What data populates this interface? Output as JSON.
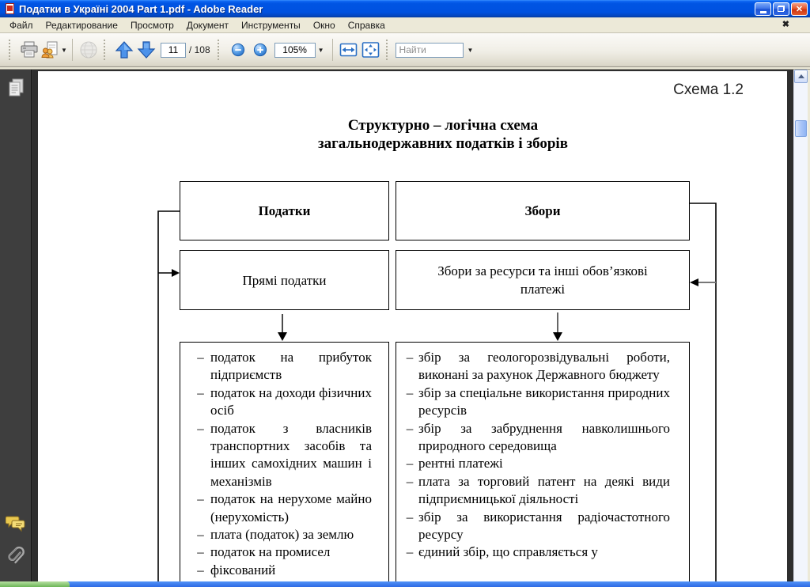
{
  "window": {
    "title": "Податки в Україні 2004 Part 1.pdf - Adobe Reader",
    "mdi_close_glyph": "✖"
  },
  "menu": {
    "items": [
      "Файл",
      "Редактирование",
      "Просмотр",
      "Документ",
      "Инструменты",
      "Окно",
      "Справка"
    ]
  },
  "toolbar": {
    "page_current": "11",
    "page_total": "/ 108",
    "zoom_level": "105%",
    "find_placeholder": "Найти"
  },
  "sidebar": {
    "icons": [
      "pages-icon",
      "comments-icon",
      "attachments-icon"
    ]
  },
  "colors": {
    "titlebar_blue": "#0054e3",
    "close_red": "#ce3511",
    "taskbar_blue": "#2f6ae4",
    "start_green": "#6cb657",
    "sidebar_gray": "#3e3e3e"
  },
  "document": {
    "schema_label": "Схема 1.2",
    "title_line1": "Структурно – логічна схема",
    "title_line2": "загальнодержавних податків і зборів",
    "bullet": "–",
    "boxes": {
      "taxes": "Податки",
      "fees": "Збори",
      "direct_taxes": "Прямі податки",
      "resource_fees": "Збори  за ресурси та інші обов’язкові платежі"
    },
    "left_list": [
      "податок на прибуток підприємств",
      "податок на доходи фізичних осіб",
      "податок з власників транспортних засобів та інших самохідних машин і механізмів",
      "податок на нерухоме майно (нерухомість)",
      "плата (податок) за землю",
      "податок на промисел",
      "фіксований"
    ],
    "right_list": [
      "збір за геологорозвідувальні роботи, виконані за рахунок Державного бюджету",
      "збір за спеціальне використання природних ресурсів",
      "збір за забруднення навколишнього природного середовища",
      "рентні платежі",
      "плата за торговий патент на деякі види підприємницької діяльності",
      "збір за використання радіочастотного ресурсу",
      "єдиний збір, що справляється у"
    ]
  }
}
